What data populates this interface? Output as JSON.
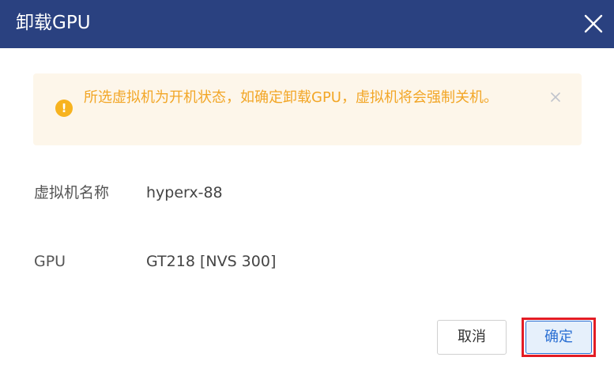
{
  "dialog": {
    "title": "卸载GPU",
    "close_icon": "close-icon"
  },
  "alert": {
    "icon": "warning-icon",
    "text": "所选虚拟机为开机状态，如确定卸载GPU，虚拟机将会强制关机。",
    "close_icon": "close-icon",
    "colors": {
      "background": "#fdf6ea",
      "text": "#f2a626",
      "icon": "#f7b31f"
    }
  },
  "details": [
    {
      "label": "虚拟机名称",
      "value": "hyperx-88"
    },
    {
      "label": "GPU",
      "value": "GT218 [NVS 300]"
    }
  ],
  "buttons": {
    "cancel_label": "取消",
    "ok_label": "确定"
  },
  "colors": {
    "header": "#2a4180",
    "primary": "#2a6fd3",
    "highlight": "#e31c24"
  }
}
